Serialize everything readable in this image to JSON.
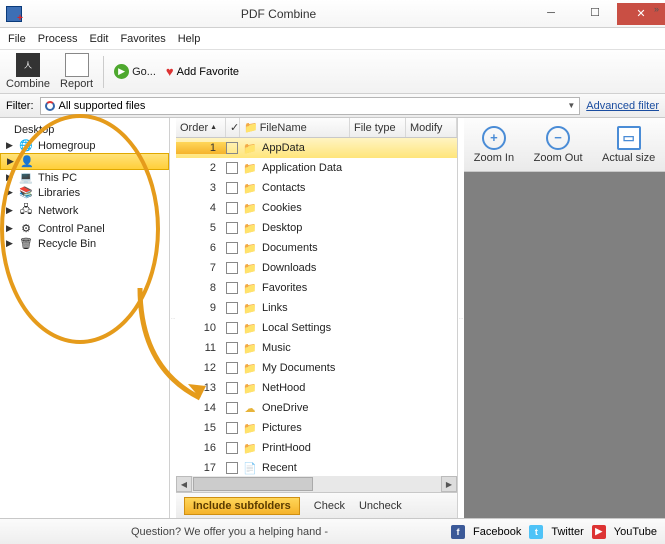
{
  "title": "PDF Combine",
  "menu": [
    "File",
    "Process",
    "Edit",
    "Favorites",
    "Help"
  ],
  "toolbar": {
    "combine": "Combine",
    "report": "Report",
    "go": "Go...",
    "addfav": "Add Favorite"
  },
  "filter": {
    "label": "Filter:",
    "value": "All supported files",
    "adv": "Advanced filter"
  },
  "sidebar": {
    "root": "Desktop",
    "items": [
      {
        "label": "Homegroup",
        "icon": "🌐"
      },
      {
        "label": "",
        "icon": "👤",
        "hl": true
      },
      {
        "label": "This PC",
        "icon": "💻"
      },
      {
        "label": "Libraries",
        "icon": "📚"
      },
      {
        "label": "Network",
        "icon": "🖧"
      },
      {
        "label": "Control Panel",
        "icon": "⚙"
      },
      {
        "label": "Recycle Bin",
        "icon": "🗑"
      }
    ]
  },
  "cols": {
    "order": "Order",
    "filename": "FileName",
    "filetype": "File type",
    "modify": "Modify"
  },
  "files": [
    {
      "o": 1,
      "n": "AppData",
      "i": "📁",
      "s": true
    },
    {
      "o": 2,
      "n": "Application Data",
      "i": "📁"
    },
    {
      "o": 3,
      "n": "Contacts",
      "i": "📁"
    },
    {
      "o": 4,
      "n": "Cookies",
      "i": "📁"
    },
    {
      "o": 5,
      "n": "Desktop",
      "i": "📁"
    },
    {
      "o": 6,
      "n": "Documents",
      "i": "📁"
    },
    {
      "o": 7,
      "n": "Downloads",
      "i": "📁"
    },
    {
      "o": 8,
      "n": "Favorites",
      "i": "📁"
    },
    {
      "o": 9,
      "n": "Links",
      "i": "📁"
    },
    {
      "o": 10,
      "n": "Local Settings",
      "i": "📁"
    },
    {
      "o": 11,
      "n": "Music",
      "i": "📁"
    },
    {
      "o": 12,
      "n": "My Documents",
      "i": "📁"
    },
    {
      "o": 13,
      "n": "NetHood",
      "i": "📁"
    },
    {
      "o": 14,
      "n": "OneDrive",
      "i": "☁"
    },
    {
      "o": 15,
      "n": "Pictures",
      "i": "📁"
    },
    {
      "o": 16,
      "n": "PrintHood",
      "i": "📁"
    },
    {
      "o": 17,
      "n": "Recent",
      "i": "📄"
    }
  ],
  "bottom": {
    "inc": "Include subfolders",
    "check": "Check",
    "uncheck": "Uncheck"
  },
  "preview": {
    "zoomin": "Zoom In",
    "zoomout": "Zoom Out",
    "actual": "Actual size"
  },
  "status": {
    "q": "Question? We offer you a helping hand -",
    "fb": "Facebook",
    "tw": "Twitter",
    "yt": "YouTube"
  }
}
